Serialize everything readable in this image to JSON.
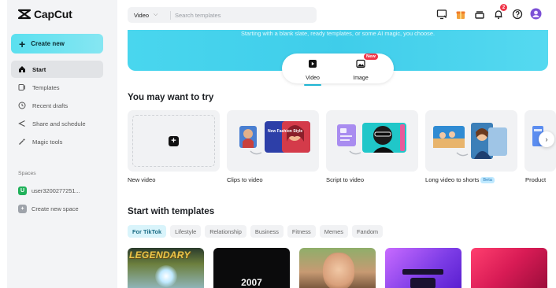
{
  "app": {
    "name": "CapCut"
  },
  "sidebar": {
    "create_label": "Create new",
    "items": [
      {
        "label": "Start",
        "icon": "home-icon",
        "active": true
      },
      {
        "label": "Templates",
        "icon": "templates-icon",
        "active": false
      },
      {
        "label": "Recent drafts",
        "icon": "clock-icon",
        "active": false
      },
      {
        "label": "Share and schedule",
        "icon": "share-icon",
        "active": false
      },
      {
        "label": "Magic tools",
        "icon": "magic-wand-icon",
        "active": false
      }
    ],
    "spaces_label": "Spaces",
    "space_user": {
      "badge": "U",
      "label": "user3200277251..."
    },
    "create_space_label": "Create new space"
  },
  "topbar": {
    "search_type": "Video",
    "search_placeholder": "Search templates",
    "notification_count": "2"
  },
  "hero": {
    "subtitle": "Starting with a blank slate, ready templates, or some AI magic, you choose.",
    "switch": {
      "video_label": "Video",
      "image_label": "Image",
      "new_tag": "New",
      "selected": "Video"
    }
  },
  "try_section": {
    "title": "You may want to try",
    "cards": [
      {
        "label": "New video"
      },
      {
        "label": "Clips to video",
        "thumb_text": "New Fashion Style"
      },
      {
        "label": "Script to video"
      },
      {
        "label": "Long video to shorts",
        "tag": "Beta",
        "thumb_text": "Tags"
      },
      {
        "label": "Product"
      }
    ]
  },
  "templates_section": {
    "title": "Start with templates",
    "tabs": [
      "For TikTok",
      "Lifestyle",
      "Relationship",
      "Business",
      "Fitness",
      "Memes",
      "Fandom"
    ],
    "active_tab": "For TikTok",
    "thumbs": [
      {
        "text": "LEGENDARY"
      },
      {
        "text": "2007"
      }
    ]
  },
  "colors": {
    "accent": "#49d6ee",
    "create_button": "#5be0ef",
    "notification": "#f0374a",
    "sidebar_bg": "#f3f4f6"
  }
}
